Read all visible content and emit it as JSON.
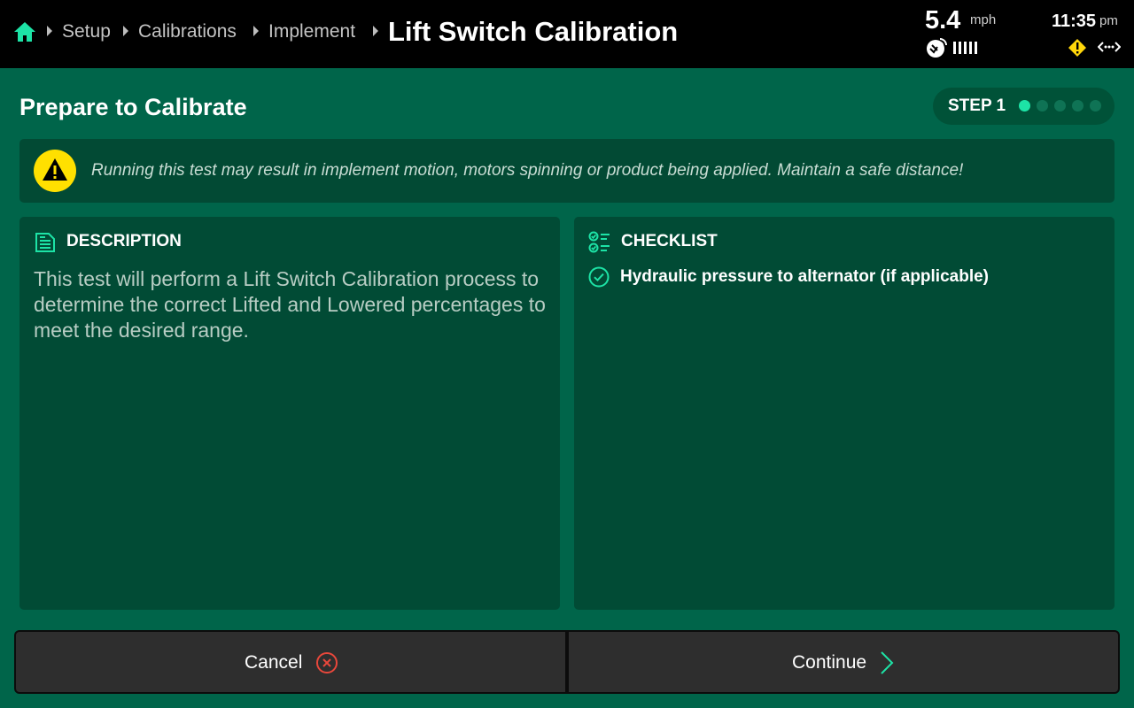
{
  "header": {
    "breadcrumbs": [
      {
        "label": "Setup"
      },
      {
        "label": "Calibrations"
      },
      {
        "label": "Implement"
      }
    ],
    "title": "Lift Switch Calibration",
    "speed": {
      "value": "5.4",
      "unit": "mph"
    },
    "clock": {
      "time": "11:35",
      "period": "pm"
    },
    "icons": {
      "home": "home-icon",
      "gps": "gps-satellite-icon",
      "signal": "signal-bars-icon",
      "alert": "warning-diamond-icon",
      "connection": "connection-arrows-icon"
    },
    "colors": {
      "home": "#1de3a6",
      "alert": "#ffd60a"
    }
  },
  "section": {
    "title": "Prepare to Calibrate",
    "step": {
      "label": "STEP 1",
      "current": 1,
      "total": 5
    }
  },
  "warning": {
    "text": "Running this test may result in implement motion, motors spinning or product being applied. Maintain a safe distance!",
    "icon": "warning-triangle-icon",
    "color": "#ffe000"
  },
  "description": {
    "heading": "DESCRIPTION",
    "icon": "document-icon",
    "body": "This test will perform a Lift Switch Calibration process to determine the correct Lifted and Lowered percentages to meet the desired range."
  },
  "checklist": {
    "heading": "CHECKLIST",
    "icon": "checklist-icon",
    "items": [
      {
        "label": "Hydraulic pressure to alternator (if applicable)",
        "checked": true
      }
    ]
  },
  "buttons": {
    "cancel": {
      "label": "Cancel",
      "icon": "cancel-circle-icon",
      "color": "#e8473b"
    },
    "continue": {
      "label": "Continue",
      "icon": "chevron-right-icon",
      "color": "#1de3a6"
    }
  },
  "theme": {
    "accent": "#1de3a6",
    "background": "#00654a",
    "panel": "#014b35"
  }
}
